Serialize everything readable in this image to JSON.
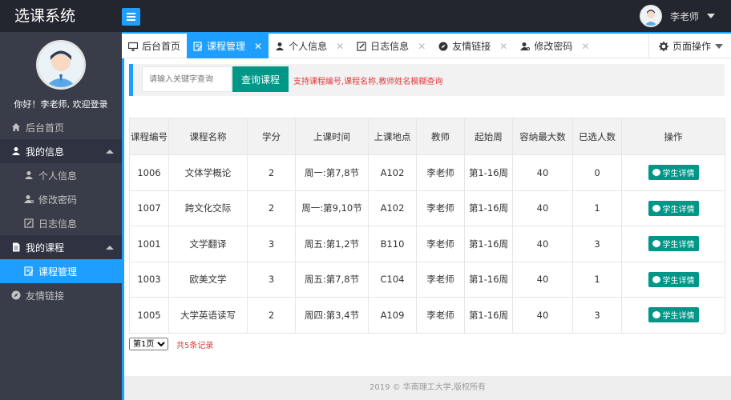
{
  "app": {
    "title": "选课系统"
  },
  "header": {
    "user_name": "李老师"
  },
  "sidebar": {
    "welcome": "你好！李老师, 欢迎登录",
    "items": [
      {
        "label": "后台首页"
      },
      {
        "label": "我的信息"
      },
      {
        "label": "个人信息"
      },
      {
        "label": "修改密码"
      },
      {
        "label": "日志信息"
      },
      {
        "label": "我的课程"
      },
      {
        "label": "课程管理"
      },
      {
        "label": "友情链接"
      }
    ]
  },
  "tabs": [
    {
      "label": "后台首页"
    },
    {
      "label": "课程管理"
    },
    {
      "label": "个人信息"
    },
    {
      "label": "日志信息"
    },
    {
      "label": "友情链接"
    },
    {
      "label": "修改密码"
    }
  ],
  "page_ops": {
    "label": "页面操作"
  },
  "search": {
    "placeholder": "请输入关键字查询",
    "button": "查询课程",
    "hint": "支持课程编号,课程名称,教师姓名模糊查询"
  },
  "table": {
    "headers": [
      "课程编号",
      "课程名称",
      "学分",
      "上课时间",
      "上课地点",
      "教师",
      "起始周",
      "容纳最大数",
      "已选人数",
      "操作"
    ],
    "rows": [
      [
        "1006",
        "文体学概论",
        "2",
        "周一:第7,8节",
        "A102",
        "李老师",
        "第1-16周",
        "40",
        "0",
        "学生详情"
      ],
      [
        "1007",
        "跨文化交际",
        "2",
        "周一:第9,10节",
        "A102",
        "李老师",
        "第1-16周",
        "40",
        "1",
        "学生详情"
      ],
      [
        "1001",
        "文学翻译",
        "3",
        "周五:第1,2节",
        "B110",
        "李老师",
        "第1-16周",
        "40",
        "3",
        "学生详情"
      ],
      [
        "1003",
        "欧美文学",
        "3",
        "周五:第7,8节",
        "C104",
        "李老师",
        "第1-16周",
        "40",
        "1",
        "学生详情"
      ],
      [
        "1005",
        "大学英语读写",
        "2",
        "周四:第3,4节",
        "A109",
        "李老师",
        "第1-16周",
        "40",
        "3",
        "学生详情"
      ]
    ]
  },
  "pager": {
    "page": "第1页",
    "total": "共5条记录"
  },
  "footer": {
    "text": "2019 © 华南理工大学,版权所有"
  },
  "colors": {
    "accent": "#1e9fff",
    "teal": "#009688",
    "sidebar": "#393d49",
    "warning_text": "#e4393c"
  }
}
